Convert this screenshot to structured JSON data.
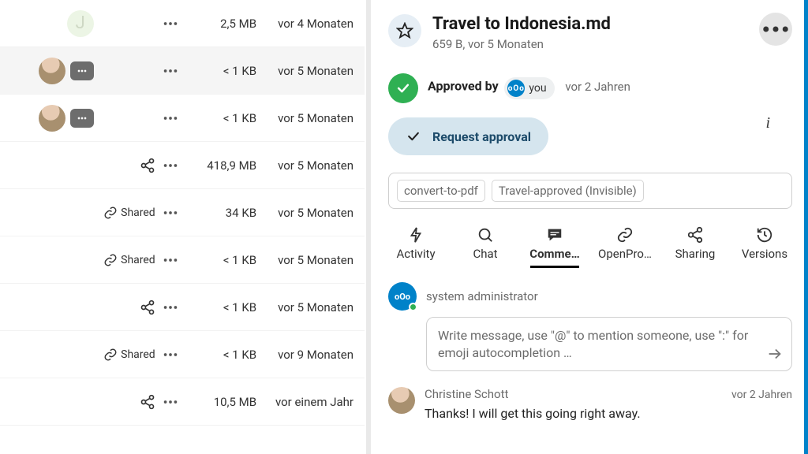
{
  "file_list": {
    "shared_label": "Shared",
    "rows": [
      {
        "thumb": "letter",
        "letter": "J",
        "has_comment": false,
        "share_mode": "none",
        "size": "2,5 MB",
        "time": "vor 4 Monaten",
        "selected": false
      },
      {
        "thumb": "photo",
        "has_comment": true,
        "share_mode": "none",
        "size": "< 1 KB",
        "time": "vor 5 Monaten",
        "selected": true
      },
      {
        "thumb": "photo",
        "has_comment": true,
        "share_mode": "none",
        "size": "< 1 KB",
        "time": "vor 5 Monaten",
        "selected": false
      },
      {
        "thumb": "none",
        "has_comment": false,
        "share_mode": "icon",
        "size": "418,9 MB",
        "time": "vor 5 Monaten",
        "selected": false
      },
      {
        "thumb": "none",
        "has_comment": false,
        "share_mode": "chip",
        "size": "34 KB",
        "time": "vor 5 Monaten",
        "selected": false
      },
      {
        "thumb": "none",
        "has_comment": false,
        "share_mode": "chip",
        "size": "< 1 KB",
        "time": "vor 5 Monaten",
        "selected": false
      },
      {
        "thumb": "none",
        "has_comment": false,
        "share_mode": "icon",
        "size": "< 1 KB",
        "time": "vor 5 Monaten",
        "selected": false
      },
      {
        "thumb": "none",
        "has_comment": false,
        "share_mode": "chip",
        "size": "< 1 KB",
        "time": "vor 9 Monaten",
        "selected": false
      },
      {
        "thumb": "none",
        "has_comment": false,
        "share_mode": "icon",
        "size": "10,5 MB",
        "time": "vor einem Jahr",
        "selected": false
      }
    ]
  },
  "details": {
    "title": "Travel to Indonesia.md",
    "subtitle": "659 B, vor 5 Monaten",
    "approval": {
      "label": "Approved by",
      "who": "you",
      "when": "vor 2 Jahren"
    },
    "request_label": "Request approval",
    "tags": [
      "convert-to-pdf",
      "Travel-approved (Invisible)"
    ],
    "tabs": {
      "activity": "Activity",
      "chat": "Chat",
      "comments": "Comme…",
      "openproject": "OpenPro…",
      "sharing": "Sharing",
      "versions": "Versions"
    },
    "comment_compose": {
      "author": "system administrator",
      "placeholder": "Write message, use \"@\" to mention someone, use \":\" for emoji autocompletion …"
    },
    "comments": [
      {
        "author": "Christine Schott",
        "time": "vor 2 Jahren",
        "body": "Thanks! I will get this going right away."
      }
    ]
  }
}
